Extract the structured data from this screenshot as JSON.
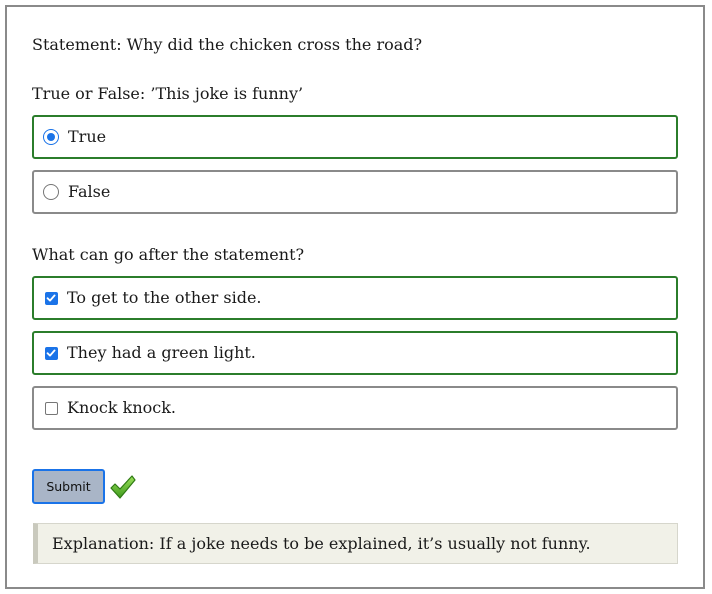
{
  "statement": "Statement: Why did the chicken cross the road?",
  "question1": {
    "label": "True or False: ’This joke is funny’",
    "options": [
      {
        "label": "True",
        "selected": true
      },
      {
        "label": "False",
        "selected": false
      }
    ]
  },
  "question2": {
    "label": "What can go after the statement?",
    "options": [
      {
        "label": "To get to the other side.",
        "checked": true
      },
      {
        "label": "They had a green light.",
        "checked": true
      },
      {
        "label": "Knock knock.",
        "checked": false
      }
    ]
  },
  "submit_label": "Submit",
  "result_icon": "green-checkmark-icon",
  "explanation": "Explanation: If a joke needs to be explained, it’s usually not funny.",
  "colors": {
    "correct_border": "#2b7d2b",
    "accent": "#1a73e8",
    "checkmark": "#5cb82a"
  }
}
